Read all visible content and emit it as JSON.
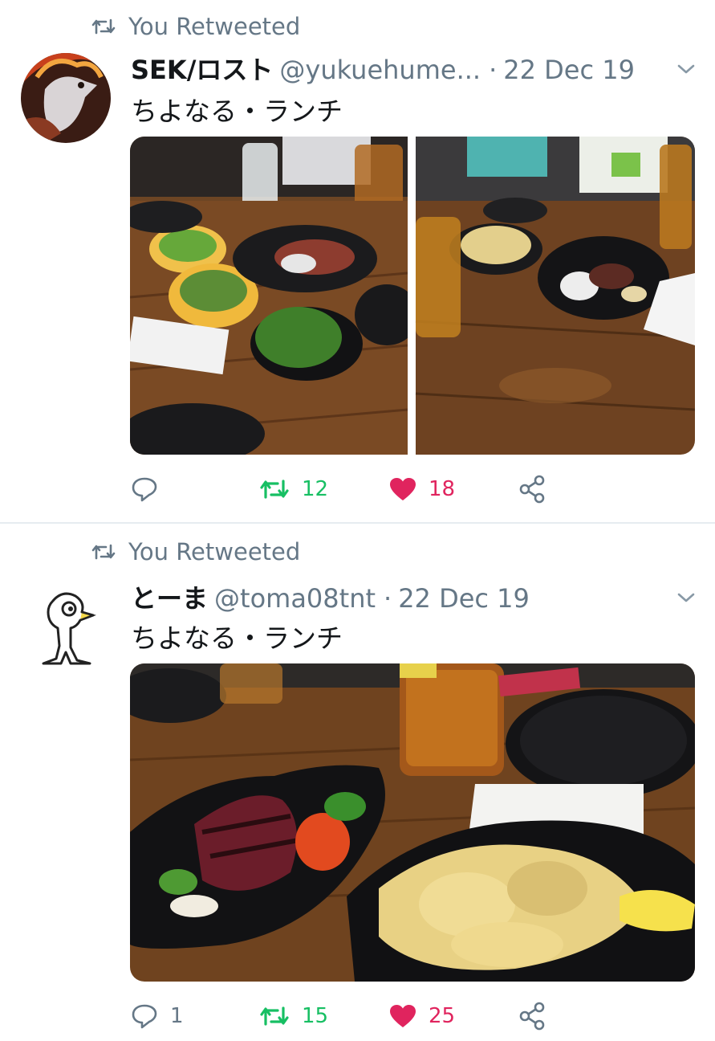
{
  "tweets": [
    {
      "retweet_label": "You Retweeted",
      "name": "SEK/ロスト",
      "handle": "@yukuehume...",
      "separator": "·",
      "date": "22 Dec 19",
      "text": "ちよなる・ランチ",
      "avatar_icon": "flaming-bird-avatar",
      "media_count": 2,
      "counts": {
        "replies": "",
        "retweets": "12",
        "likes": "18"
      },
      "retweeted": true,
      "liked": true
    },
    {
      "retweet_label": "You Retweeted",
      "name": "とーま",
      "handle": "@toma08tnt",
      "separator": "·",
      "date": "22 Dec 19",
      "text": "ちよなる・ランチ",
      "avatar_icon": "bird-sketch-avatar",
      "media_count": 1,
      "counts": {
        "replies": "1",
        "retweets": "15",
        "likes": "25"
      },
      "retweeted": true,
      "liked": true
    }
  ],
  "icons": {
    "retweet": "retweet-icon",
    "reply": "reply-icon",
    "like": "heart-icon",
    "share": "share-icon",
    "caret": "chevron-down-icon"
  },
  "colors": {
    "retweet_active": "#17bf63",
    "like_active": "#e0245e",
    "secondary_text": "#657786",
    "primary_text": "#14171a",
    "divider": "#e6ecf0"
  }
}
